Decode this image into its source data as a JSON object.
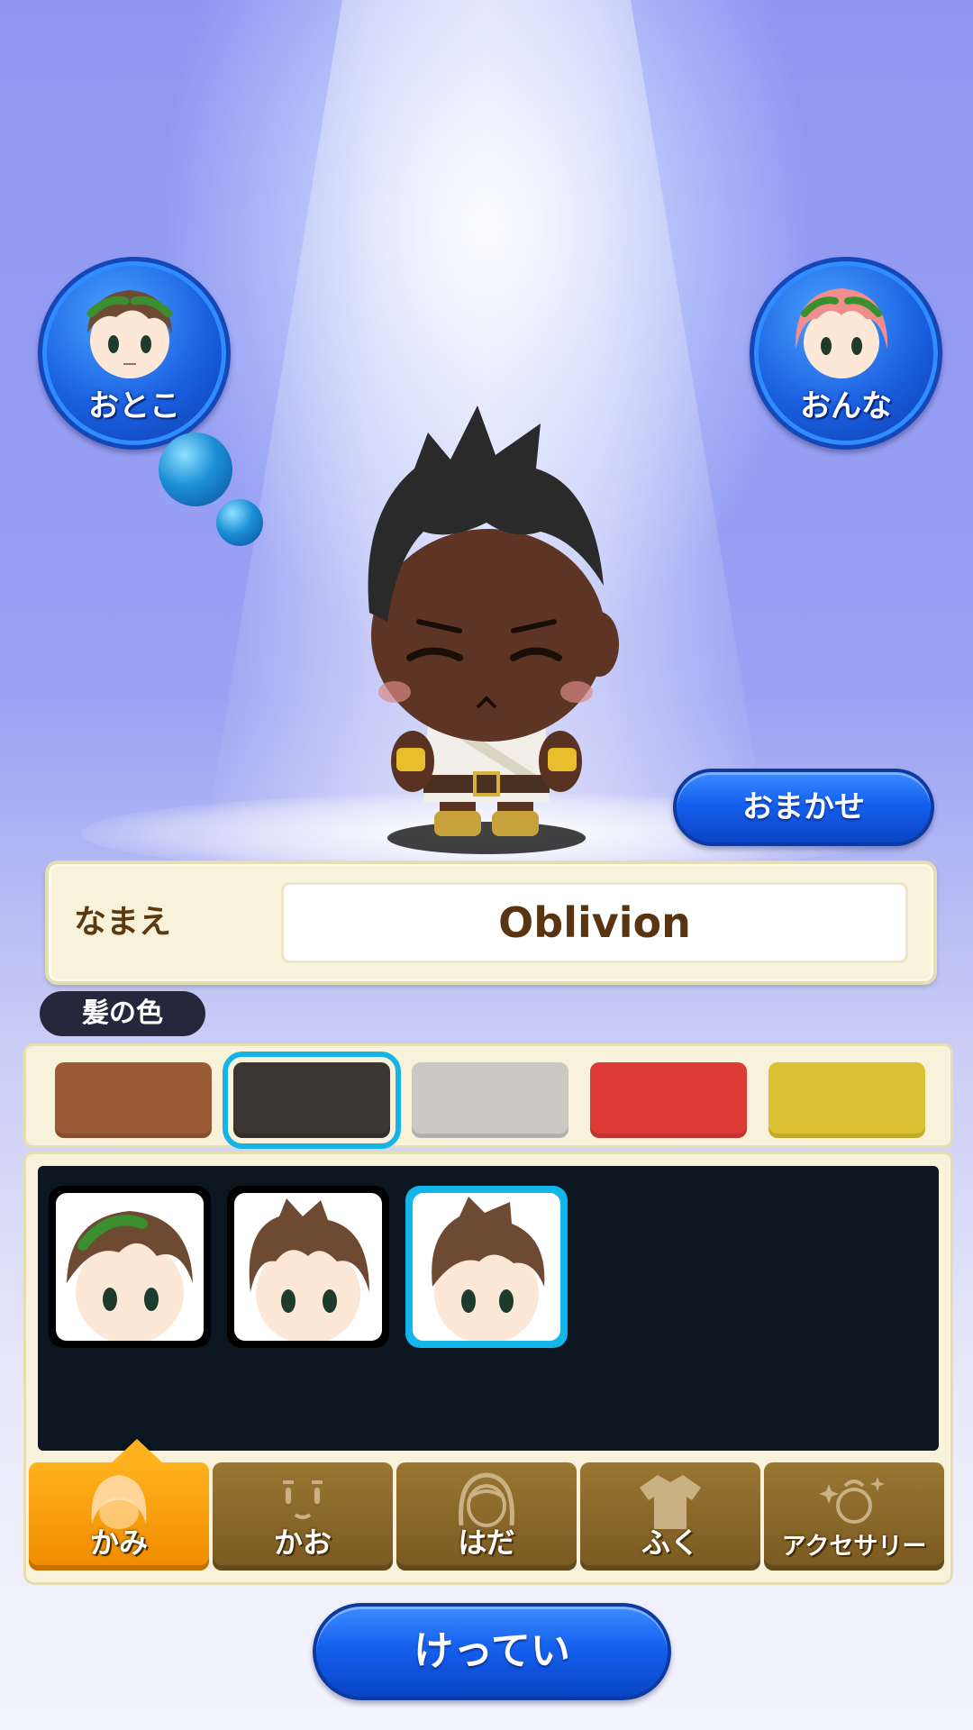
{
  "gender": {
    "male_label": "おとこ",
    "female_label": "おんな",
    "selected": "male"
  },
  "actions": {
    "random_label": "おまかせ",
    "confirm_label": "けってい"
  },
  "name": {
    "label": "なまえ",
    "value": "Oblivion"
  },
  "hair_color": {
    "section_label": "髪の色",
    "swatches": [
      "#9a5a36",
      "#3a3631",
      "#cbc9c4",
      "#de3a36",
      "#dcc233"
    ],
    "selected_index": 1
  },
  "hair_styles": {
    "count": 3,
    "selected_index": 2
  },
  "tabs": [
    {
      "label": "かみ",
      "icon": "hair-icon",
      "active": true
    },
    {
      "label": "かお",
      "icon": "face-icon",
      "active": false
    },
    {
      "label": "はだ",
      "icon": "skin-icon",
      "active": false
    },
    {
      "label": "ふく",
      "icon": "clothes-icon",
      "active": false
    },
    {
      "label": "アクセサリー",
      "icon": "accessory-icon",
      "active": false
    }
  ],
  "colors": {
    "accent_blue": "#1560ef",
    "selection_cyan": "#12b6ea",
    "tab_active": "#f08a00",
    "tab_inactive": "#7a5a22",
    "panel_cream": "#f7f2d9"
  }
}
